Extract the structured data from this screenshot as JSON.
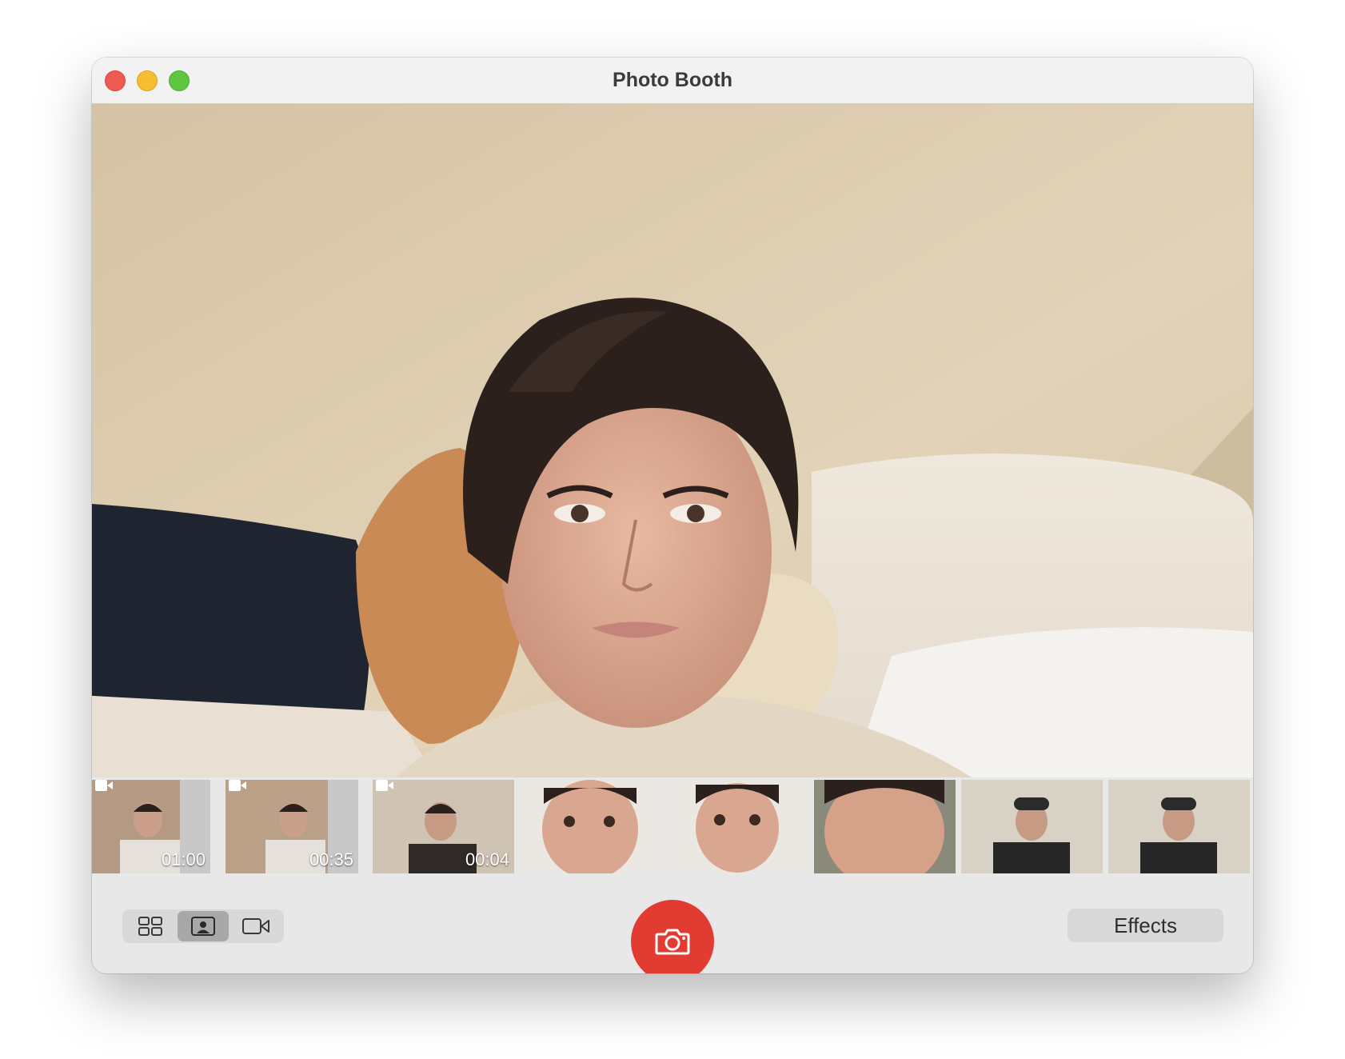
{
  "window": {
    "title": "Photo Booth"
  },
  "thumbnails": [
    {
      "type": "video",
      "duration": "01:00"
    },
    {
      "type": "video",
      "duration": "00:35"
    },
    {
      "type": "video",
      "duration": "00:04"
    },
    {
      "type": "photo",
      "duration": ""
    },
    {
      "type": "photo",
      "duration": ""
    },
    {
      "type": "photo",
      "duration": ""
    },
    {
      "type": "photo",
      "duration": ""
    },
    {
      "type": "photo",
      "duration": ""
    }
  ],
  "toolbar": {
    "view_modes": [
      {
        "name": "grid-view",
        "icon": "grid-icon",
        "active": false
      },
      {
        "name": "photo-view",
        "icon": "portrait-icon",
        "active": true
      },
      {
        "name": "video-view",
        "icon": "video-camera-icon",
        "active": false
      }
    ],
    "shutter_icon": "camera-icon",
    "effects_label": "Effects"
  },
  "colors": {
    "shutter": "#e23c32",
    "close": "#ee5a52",
    "minimize": "#f5bd2f",
    "zoom": "#5fc63f"
  }
}
